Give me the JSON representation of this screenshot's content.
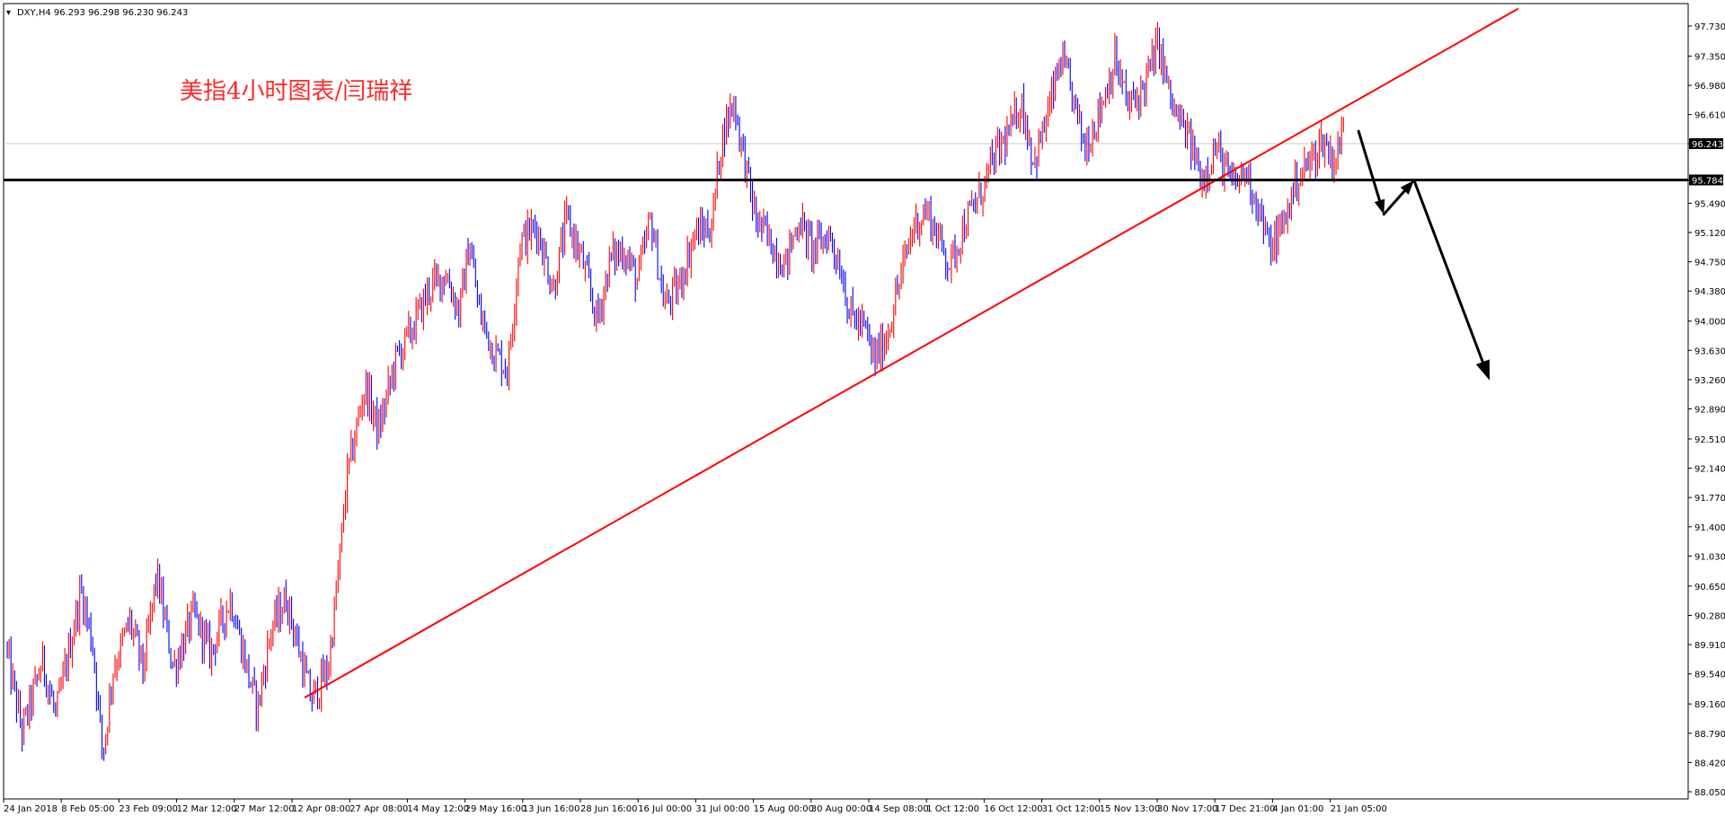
{
  "header": {
    "symbol_line": "DXY,H4  96.293 96.298 96.230 96.243",
    "annotation": "美指4小时图表/闫瑞祥"
  },
  "colors": {
    "bull": "#ff0000",
    "bear": "#0000ff",
    "trendline": "#ff0000",
    "support": "#000000",
    "arrow": "#000000"
  },
  "chart_data": {
    "type": "candlestick",
    "symbol": "DXY",
    "timeframe": "H4",
    "last_ohlc": {
      "open": 96.293,
      "high": 96.298,
      "low": 96.23,
      "close": 96.243
    },
    "ylim": [
      88.05,
      97.9
    ],
    "y_ticks": [
      "97.730",
      "97.350",
      "96.980",
      "96.610",
      "96.243",
      "95.784",
      "95.490",
      "95.120",
      "94.750",
      "94.380",
      "94.000",
      "93.630",
      "93.260",
      "92.890",
      "92.510",
      "92.140",
      "91.770",
      "91.400",
      "91.030",
      "90.650",
      "90.280",
      "89.910",
      "89.540",
      "89.160",
      "88.790",
      "88.420",
      "88.050"
    ],
    "price_marker_current": "96.243",
    "price_marker_support": "95.784",
    "x_ticks": [
      "24 Jan 2018",
      "8 Feb 05:00",
      "23 Feb 09:00",
      "12 Mar 12:00",
      "27 Mar 12:00",
      "12 Apr 08:00",
      "27 Apr 08:00",
      "14 May 12:00",
      "29 May 16:00",
      "13 Jun 16:00",
      "28 Jun 16:00",
      "16 Jul 00:00",
      "31 Jul 00:00",
      "15 Aug 00:00",
      "30 Aug 00:00",
      "14 Sep 08:00",
      "1 Oct 12:00",
      "16 Oct 12:00",
      "31 Oct 12:00",
      "15 Nov 13:00",
      "30 Nov 17:00",
      "17 Dec 21:00",
      "4 Jan 01:00",
      "21 Jan 05:00"
    ],
    "anchors": [
      [
        0,
        89.9
      ],
      [
        0.01,
        88.8
      ],
      [
        0.022,
        89.7
      ],
      [
        0.03,
        89.0
      ],
      [
        0.045,
        90.6
      ],
      [
        0.052,
        89.9
      ],
      [
        0.058,
        88.5
      ],
      [
        0.064,
        89.6
      ],
      [
        0.074,
        90.2
      ],
      [
        0.082,
        89.6
      ],
      [
        0.09,
        90.8
      ],
      [
        0.1,
        89.6
      ],
      [
        0.112,
        90.3
      ],
      [
        0.122,
        89.8
      ],
      [
        0.134,
        90.5
      ],
      [
        0.146,
        89.4
      ],
      [
        0.15,
        89.1
      ],
      [
        0.158,
        90.1
      ],
      [
        0.167,
        90.5
      ],
      [
        0.174,
        89.9
      ],
      [
        0.182,
        89.2
      ],
      [
        0.192,
        89.6
      ],
      [
        0.198,
        90.8
      ],
      [
        0.203,
        92.0
      ],
      [
        0.214,
        93.2
      ],
      [
        0.222,
        92.6
      ],
      [
        0.232,
        93.5
      ],
      [
        0.242,
        93.9
      ],
      [
        0.252,
        94.4
      ],
      [
        0.262,
        94.6
      ],
      [
        0.27,
        94.1
      ],
      [
        0.276,
        95.0
      ],
      [
        0.282,
        94.1
      ],
      [
        0.291,
        93.6
      ],
      [
        0.299,
        93.4
      ],
      [
        0.306,
        95.0
      ],
      [
        0.316,
        95.2
      ],
      [
        0.326,
        94.4
      ],
      [
        0.334,
        95.3
      ],
      [
        0.344,
        94.7
      ],
      [
        0.352,
        94.0
      ],
      [
        0.36,
        94.8
      ],
      [
        0.368,
        94.9
      ],
      [
        0.376,
        94.5
      ],
      [
        0.384,
        95.3
      ],
      [
        0.392,
        94.2
      ],
      [
        0.4,
        94.4
      ],
      [
        0.41,
        95.1
      ],
      [
        0.42,
        95.2
      ],
      [
        0.426,
        96.3
      ],
      [
        0.433,
        96.8
      ],
      [
        0.44,
        96.0
      ],
      [
        0.446,
        95.3
      ],
      [
        0.455,
        95.0
      ],
      [
        0.464,
        94.7
      ],
      [
        0.472,
        95.3
      ],
      [
        0.48,
        94.9
      ],
      [
        0.49,
        95.1
      ],
      [
        0.498,
        94.6
      ],
      [
        0.502,
        94.1
      ],
      [
        0.511,
        93.9
      ],
      [
        0.517,
        93.5
      ],
      [
        0.524,
        93.8
      ],
      [
        0.532,
        94.5
      ],
      [
        0.54,
        95.2
      ],
      [
        0.548,
        95.4
      ],
      [
        0.556,
        95.0
      ],
      [
        0.562,
        94.7
      ],
      [
        0.57,
        95.2
      ],
      [
        0.58,
        95.6
      ],
      [
        0.589,
        96.1
      ],
      [
        0.598,
        96.4
      ],
      [
        0.604,
        96.8
      ],
      [
        0.612,
        96.0
      ],
      [
        0.62,
        96.6
      ],
      [
        0.628,
        97.3
      ],
      [
        0.634,
        96.9
      ],
      [
        0.642,
        96.2
      ],
      [
        0.65,
        96.6
      ],
      [
        0.66,
        97.3
      ],
      [
        0.668,
        96.7
      ],
      [
        0.676,
        96.9
      ],
      [
        0.686,
        97.5
      ],
      [
        0.694,
        96.7
      ],
      [
        0.704,
        96.3
      ],
      [
        0.712,
        95.8
      ],
      [
        0.72,
        96.2
      ],
      [
        0.73,
        95.7
      ],
      [
        0.738,
        95.9
      ],
      [
        0.746,
        95.4
      ],
      [
        0.752,
        94.9
      ],
      [
        0.76,
        95.2
      ],
      [
        0.768,
        95.8
      ],
      [
        0.776,
        96.0
      ],
      [
        0.784,
        96.3
      ],
      [
        0.79,
        96.0
      ],
      [
        0.796,
        96.4
      ]
    ],
    "trendline": {
      "from": {
        "x_frac": 0.178,
        "price": 89.24
      },
      "to": {
        "x_frac": 0.9,
        "price": 97.95
      }
    },
    "support_level": 95.784,
    "projection": [
      {
        "x_frac": 0.805,
        "price": 96.4
      },
      {
        "x_frac": 0.82,
        "price": 95.35
      },
      {
        "x_frac": 0.838,
        "price": 95.78
      },
      {
        "x_frac": 0.883,
        "price": 93.25
      }
    ]
  }
}
